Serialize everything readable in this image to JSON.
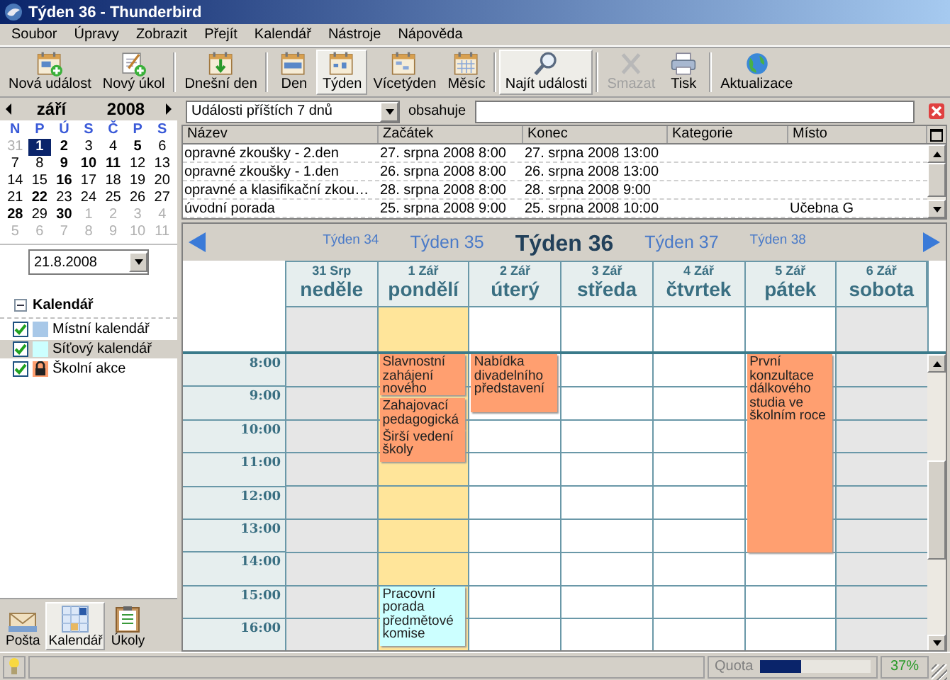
{
  "window": {
    "title": "Týden 36 - Thunderbird"
  },
  "menu": [
    "Soubor",
    "Úpravy",
    "Zobrazit",
    "Přejít",
    "Kalendář",
    "Nástroje",
    "Nápověda"
  ],
  "toolbar": [
    {
      "buttons": [
        {
          "label": "Nová událost",
          "kind": "newevent",
          "selected": false,
          "disabled": false
        },
        {
          "label": "Nový úkol",
          "kind": "newtask",
          "selected": false,
          "disabled": false
        }
      ]
    },
    {
      "buttons": [
        {
          "label": "Dnešní den",
          "kind": "today",
          "selected": false,
          "disabled": false
        }
      ]
    },
    {
      "buttons": [
        {
          "label": "Den",
          "kind": "day",
          "selected": false,
          "disabled": false
        },
        {
          "label": "Týden",
          "kind": "week",
          "selected": true,
          "disabled": false
        },
        {
          "label": "Vícetýden",
          "kind": "multiweek",
          "selected": false,
          "disabled": false
        },
        {
          "label": "Měsíc",
          "kind": "month",
          "selected": false,
          "disabled": false
        }
      ]
    },
    {
      "buttons": [
        {
          "label": "Najít události",
          "kind": "find",
          "selected": true,
          "disabled": false
        }
      ]
    },
    {
      "buttons": [
        {
          "label": "Smazat",
          "kind": "delete",
          "selected": false,
          "disabled": true
        },
        {
          "label": "Tisk",
          "kind": "print",
          "selected": false,
          "disabled": false
        }
      ]
    },
    {
      "buttons": [
        {
          "label": "Aktualizace",
          "kind": "update",
          "selected": false,
          "disabled": false
        }
      ]
    }
  ],
  "minical": {
    "month": "září",
    "year": "2008",
    "weekdays": [
      "N",
      "P",
      "Ú",
      "S",
      "Č",
      "P",
      "S"
    ],
    "weeks": [
      [
        {
          "day": "31",
          "outside": true,
          "busy": false,
          "selected": false
        },
        {
          "day": "1",
          "outside": false,
          "busy": true,
          "selected": true
        },
        {
          "day": "2",
          "outside": false,
          "busy": true,
          "selected": false
        },
        {
          "day": "3",
          "outside": false,
          "busy": false,
          "selected": false
        },
        {
          "day": "4",
          "outside": false,
          "busy": false,
          "selected": false
        },
        {
          "day": "5",
          "outside": false,
          "busy": true,
          "selected": false
        },
        {
          "day": "6",
          "outside": false,
          "busy": false,
          "selected": false
        }
      ],
      [
        {
          "day": "7",
          "outside": false,
          "busy": false,
          "selected": false
        },
        {
          "day": "8",
          "outside": false,
          "busy": false,
          "selected": false
        },
        {
          "day": "9",
          "outside": false,
          "busy": true,
          "selected": false
        },
        {
          "day": "10",
          "outside": false,
          "busy": true,
          "selected": false
        },
        {
          "day": "11",
          "outside": false,
          "busy": true,
          "selected": false
        },
        {
          "day": "12",
          "outside": false,
          "busy": false,
          "selected": false
        },
        {
          "day": "13",
          "outside": false,
          "busy": false,
          "selected": false
        }
      ],
      [
        {
          "day": "14",
          "outside": false,
          "busy": false,
          "selected": false
        },
        {
          "day": "15",
          "outside": false,
          "busy": false,
          "selected": false
        },
        {
          "day": "16",
          "outside": false,
          "busy": true,
          "selected": false
        },
        {
          "day": "17",
          "outside": false,
          "busy": false,
          "selected": false
        },
        {
          "day": "18",
          "outside": false,
          "busy": false,
          "selected": false
        },
        {
          "day": "19",
          "outside": false,
          "busy": false,
          "selected": false
        },
        {
          "day": "20",
          "outside": false,
          "busy": false,
          "selected": false
        }
      ],
      [
        {
          "day": "21",
          "outside": false,
          "busy": false,
          "selected": false
        },
        {
          "day": "22",
          "outside": false,
          "busy": true,
          "selected": false
        },
        {
          "day": "23",
          "outside": false,
          "busy": false,
          "selected": false
        },
        {
          "day": "24",
          "outside": false,
          "busy": false,
          "selected": false
        },
        {
          "day": "25",
          "outside": false,
          "busy": false,
          "selected": false
        },
        {
          "day": "26",
          "outside": false,
          "busy": false,
          "selected": false
        },
        {
          "day": "27",
          "outside": false,
          "busy": false,
          "selected": false
        }
      ],
      [
        {
          "day": "28",
          "outside": false,
          "busy": true,
          "selected": false
        },
        {
          "day": "29",
          "outside": false,
          "busy": false,
          "selected": false
        },
        {
          "day": "30",
          "outside": false,
          "busy": true,
          "selected": false
        },
        {
          "day": "1",
          "outside": true,
          "busy": false,
          "selected": false
        },
        {
          "day": "2",
          "outside": true,
          "busy": false,
          "selected": false
        },
        {
          "day": "3",
          "outside": true,
          "busy": false,
          "selected": false
        },
        {
          "day": "4",
          "outside": true,
          "busy": false,
          "selected": false
        }
      ],
      [
        {
          "day": "5",
          "outside": true,
          "busy": false,
          "selected": false
        },
        {
          "day": "6",
          "outside": true,
          "busy": false,
          "selected": false
        },
        {
          "day": "7",
          "outside": true,
          "busy": false,
          "selected": false
        },
        {
          "day": "8",
          "outside": true,
          "busy": false,
          "selected": false
        },
        {
          "day": "9",
          "outside": true,
          "busy": false,
          "selected": false
        },
        {
          "day": "10",
          "outside": true,
          "busy": false,
          "selected": false
        },
        {
          "day": "11",
          "outside": true,
          "busy": false,
          "selected": false
        }
      ]
    ]
  },
  "date_field": {
    "value": "21.8.2008"
  },
  "calendars": {
    "title": "Kalendář",
    "expanded": true,
    "items": [
      {
        "name": "Místní kalendář",
        "checked": true,
        "color": "#a8c8e8",
        "selected": false,
        "locked": false
      },
      {
        "name": "Síťový kalendář",
        "checked": true,
        "color": "#ccffff",
        "selected": true,
        "locked": false
      },
      {
        "name": "Školní akce",
        "checked": true,
        "color": "#ff9f70",
        "selected": false,
        "locked": true
      }
    ]
  },
  "modes": [
    {
      "label": "Pošta",
      "kind": "mail",
      "selected": false
    },
    {
      "label": "Kalendář",
      "kind": "calendar",
      "selected": true
    },
    {
      "label": "Úkoly",
      "kind": "tasks",
      "selected": false
    }
  ],
  "filter": {
    "range": "Události příštích 7 dnů",
    "label": "obsahuje"
  },
  "events_list": {
    "columns": [
      "Název",
      "Začátek",
      "Konec",
      "Kategorie",
      "Místo"
    ],
    "rows": [
      {
        "name": "opravné zkoušky - 2.den",
        "start": "27. srpna 2008 8:00",
        "end": "27. srpna 2008 13:00"
      },
      {
        "name": "opravné zkoušky - 1.den",
        "start": "26. srpna 2008 8:00",
        "end": "26. srpna 2008 13:00"
      },
      {
        "name": "opravné a klasifikační zkou…",
        "start": "28. srpna 2008 8:00",
        "end": "28. srpna 2008 9:00"
      },
      {
        "name": "úvodní porada",
        "start": "25. srpna 2008 9:00",
        "end": "25. srpna 2008 10:00",
        "location": "Učebna G"
      }
    ]
  },
  "week_nav": [
    {
      "label": "Týden 34",
      "selected": false
    },
    {
      "label": "Týden 35",
      "selected": false
    },
    {
      "label": "Týden 36",
      "selected": true
    },
    {
      "label": "Týden 37",
      "selected": false
    },
    {
      "label": "Týden 38",
      "selected": false
    }
  ],
  "days": [
    {
      "date": "31 Srp",
      "name": "neděle",
      "weekend": true,
      "selected": false
    },
    {
      "date": "1 Zář",
      "name": "pondělí",
      "weekend": false,
      "selected": true,
      "events": [
        {
          "title": "Slavnostní zahájení nového",
          "color": "#ff9f70"
        },
        {
          "title": "Zahajovací pedagogická",
          "color": "#ff9f70"
        },
        {
          "title": "Širší vedení školy",
          "color": "#ff9f70"
        },
        {
          "title": "Pracovní porada předmětové komise",
          "color": "#ccffff"
        }
      ]
    },
    {
      "date": "2 Zář",
      "name": "úterý",
      "weekend": false,
      "selected": false,
      "events": [
        {
          "title": "Nabídka divadelního představení",
          "color": "#ff9f70"
        }
      ]
    },
    {
      "date": "3 Zář",
      "name": "středa",
      "weekend": false,
      "selected": false
    },
    {
      "date": "4 Zář",
      "name": "čtvrtek",
      "weekend": false,
      "selected": false
    },
    {
      "date": "5 Zář",
      "name": "pátek",
      "weekend": false,
      "selected": false,
      "events": [
        {
          "title": "První konzultace dálkového studia ve školním roce",
          "color": "#ff9f70"
        }
      ]
    },
    {
      "date": "6 Zář",
      "name": "sobota",
      "weekend": true,
      "selected": false
    }
  ],
  "hours": [
    "8:00",
    "9:00",
    "10:00",
    "11:00",
    "12:00",
    "13:00",
    "14:00",
    "15:00",
    "16:00"
  ],
  "status": {
    "quota_label": "Quota",
    "level": 0.37,
    "reading": "37%"
  }
}
